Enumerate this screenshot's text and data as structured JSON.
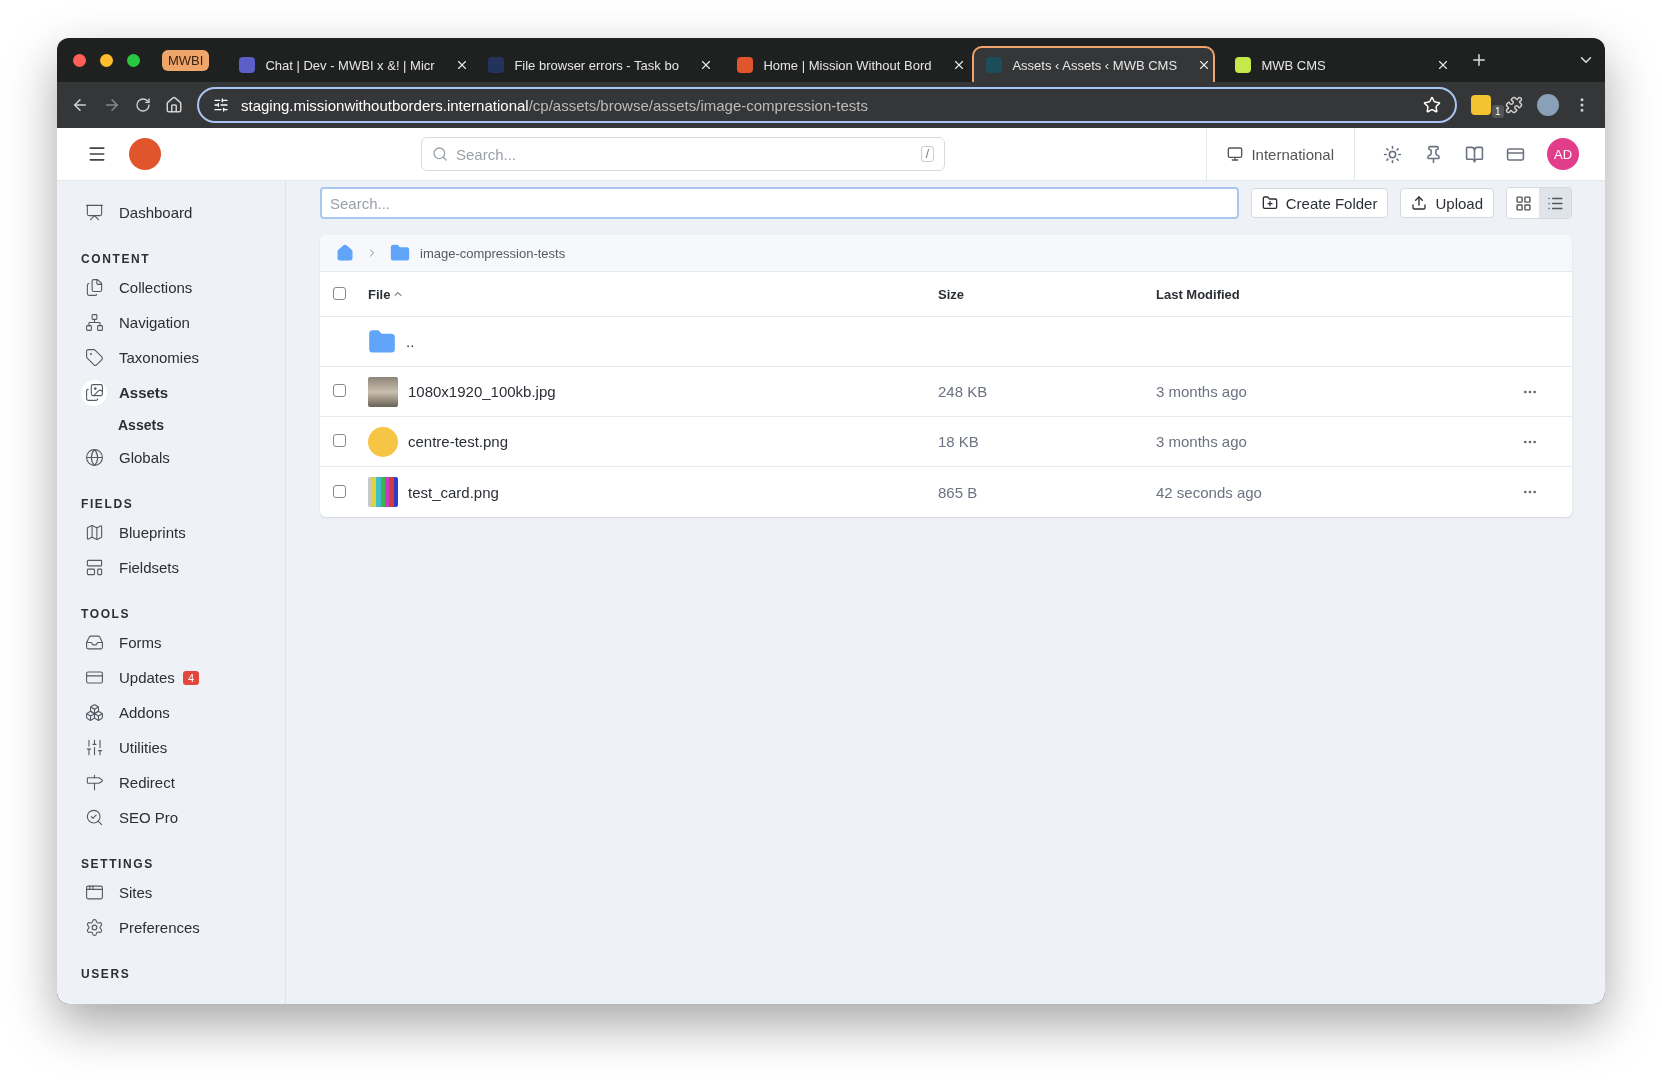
{
  "browser": {
    "tab_group": "MWBI",
    "tabs": [
      {
        "title": "Chat | Dev - MWBI x &! | Micr",
        "selected": false
      },
      {
        "title": "File browser errors - Task bo",
        "selected": false
      },
      {
        "title": "Home | Mission Without Bord",
        "selected": false
      },
      {
        "title": "Assets ‹ Assets ‹ MWB CMS",
        "selected": true
      },
      {
        "title": "MWB CMS",
        "selected": false
      }
    ],
    "url_host": "staging.missionwithoutborders.international",
    "url_path": "/cp/assets/browse/assets/image-compression-tests",
    "extension_badge": "1"
  },
  "header": {
    "search_placeholder": "Search...",
    "shortcut": "/",
    "site": "International",
    "avatar": "AD"
  },
  "sidebar": [
    {
      "items": [
        {
          "label": "Dashboard",
          "selected": false
        }
      ]
    },
    {
      "heading": "CONTENT",
      "items": [
        {
          "label": "Collections",
          "selected": false
        },
        {
          "label": "Navigation",
          "selected": false
        },
        {
          "label": "Taxonomies",
          "selected": false
        },
        {
          "label": "Assets",
          "selected": true,
          "children": [
            {
              "label": "Assets",
              "selected": true
            }
          ]
        },
        {
          "label": "Globals",
          "selected": false
        }
      ]
    },
    {
      "heading": "FIELDS",
      "items": [
        {
          "label": "Blueprints",
          "selected": false
        },
        {
          "label": "Fieldsets",
          "selected": false
        }
      ]
    },
    {
      "heading": "TOOLS",
      "items": [
        {
          "label": "Forms",
          "selected": false
        },
        {
          "label": "Updates",
          "selected": false,
          "badge": "4"
        },
        {
          "label": "Addons",
          "selected": false
        },
        {
          "label": "Utilities",
          "selected": false
        },
        {
          "label": "Redirect",
          "selected": false
        },
        {
          "label": "SEO Pro",
          "selected": false
        }
      ]
    },
    {
      "heading": "SETTINGS",
      "items": [
        {
          "label": "Sites",
          "selected": false
        },
        {
          "label": "Preferences",
          "selected": false
        }
      ]
    },
    {
      "heading": "USERS"
    }
  ],
  "toolbar": {
    "search_placeholder": "Search...",
    "buttons": [
      "Create Folder",
      "Upload"
    ],
    "views": [
      {
        "kind": "grid",
        "selected": false
      },
      {
        "kind": "list",
        "selected": true
      }
    ]
  },
  "breadcrumb": "image-compression-tests",
  "table": {
    "all_checked": false,
    "columns": [
      {
        "label": "File",
        "sorted": true
      },
      {
        "label": "Size",
        "sorted": false
      },
      {
        "label": "Last Modified",
        "sorted": false
      }
    ],
    "rows": [
      {
        "kind": "folder",
        "name": ".."
      },
      {
        "kind": "photo",
        "name": "1080x1920_100kb.jpg",
        "size": "248 KB",
        "modified": "3 months ago",
        "checked": false
      },
      {
        "kind": "circle",
        "name": "centre-test.png",
        "size": "18 KB",
        "modified": "3 months ago",
        "checked": false
      },
      {
        "kind": "testcard",
        "name": "test_card.png",
        "size": "865 B",
        "modified": "42 seconds ago",
        "checked": false
      }
    ]
  }
}
